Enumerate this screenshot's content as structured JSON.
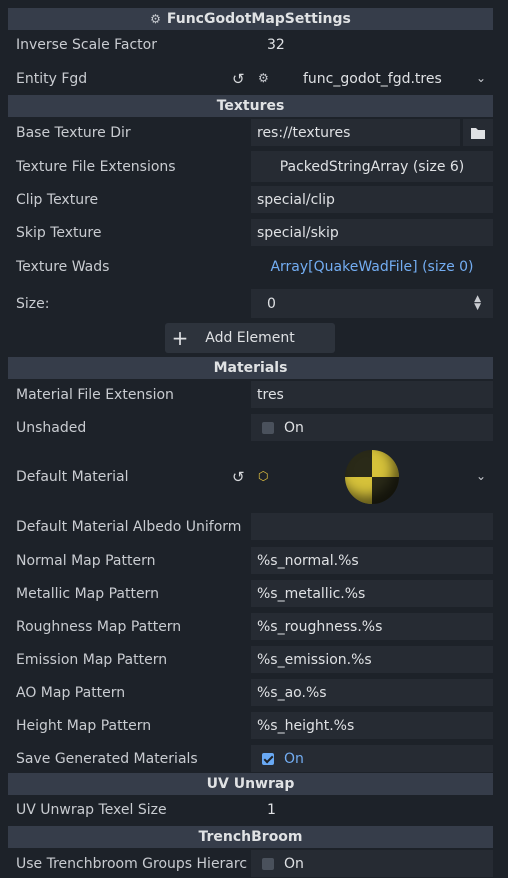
{
  "header": {
    "title": "FuncGodotMapSettings"
  },
  "general": {
    "inverse_scale_label": "Inverse Scale Factor",
    "inverse_scale_value": "32",
    "entity_fgd_label": "Entity Fgd",
    "entity_fgd_value": "func_godot_fgd.tres"
  },
  "textures": {
    "section": "Textures",
    "base_dir_label": "Base Texture Dir",
    "base_dir_value": "res://textures",
    "ext_label": "Texture File Extensions",
    "ext_value": "PackedStringArray (size 6)",
    "clip_label": "Clip Texture",
    "clip_value": "special/clip",
    "skip_label": "Skip Texture",
    "skip_value": "special/skip",
    "wads_label": "Texture Wads",
    "wads_value": "Array[QuakeWadFile] (size 0)",
    "size_label": "Size:",
    "size_value": "0",
    "add_element": "Add Element"
  },
  "materials": {
    "section": "Materials",
    "ext_label": "Material File Extension",
    "ext_value": "tres",
    "unshaded_label": "Unshaded",
    "unshaded_value": "On",
    "default_label": "Default Material",
    "albedo_label": "Default Material Albedo Uniform",
    "albedo_value": "",
    "normal_label": "Normal Map Pattern",
    "normal_value": "%s_normal.%s",
    "metallic_label": "Metallic Map Pattern",
    "metallic_value": "%s_metallic.%s",
    "roughness_label": "Roughness Map Pattern",
    "roughness_value": "%s_roughness.%s",
    "emission_label": "Emission Map Pattern",
    "emission_value": "%s_emission.%s",
    "ao_label": "AO Map Pattern",
    "ao_value": "%s_ao.%s",
    "height_label": "Height Map Pattern",
    "height_value": "%s_height.%s",
    "save_label": "Save Generated Materials",
    "save_value": "On"
  },
  "uv": {
    "section": "UV Unwrap",
    "texel_label": "UV Unwrap Texel Size",
    "texel_value": "1"
  },
  "trenchbroom": {
    "section": "TrenchBroom",
    "groups_label": "Use Trenchbroom Groups Hierarc...",
    "groups_value": "On"
  },
  "colors": {
    "accent": "#69a9f4",
    "section_bg": "#363d4a",
    "field_bg": "#262b33"
  }
}
